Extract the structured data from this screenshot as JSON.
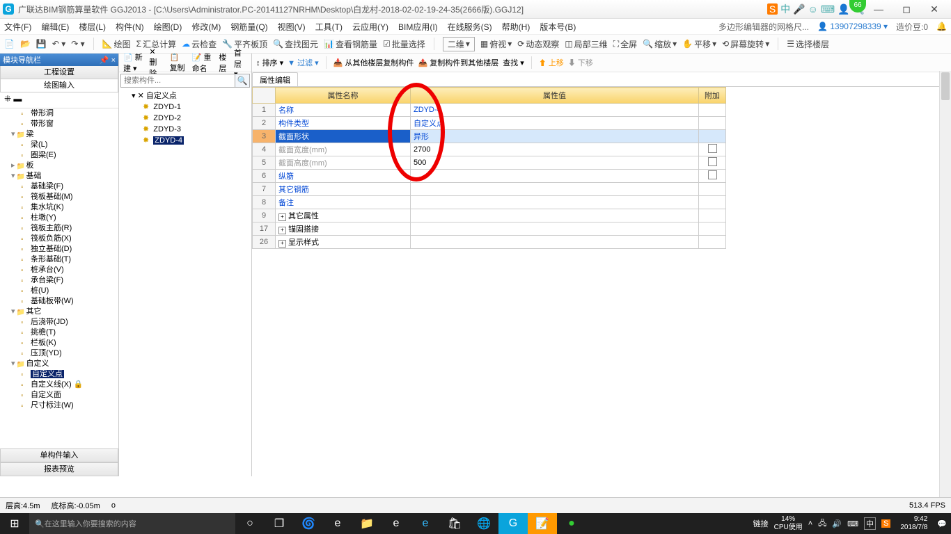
{
  "title": "广联达BIM钢筋算量软件 GGJ2013 - [C:\\Users\\Administrator.PC-20141127NRHM\\Desktop\\白龙村-2018-02-02-19-24-35(2666版).GGJ12]",
  "badge66": "66",
  "menubar": [
    "文件(F)",
    "编辑(E)",
    "楼层(L)",
    "构件(N)",
    "绘图(D)",
    "修改(M)",
    "钢筋量(Q)",
    "视图(V)",
    "工具(T)",
    "云应用(Y)",
    "BIM应用(I)",
    "在线服务(S)",
    "帮助(H)",
    "版本号(B)"
  ],
  "menubar_r": {
    "tip": "多边形编辑器的网格尺...",
    "user": "13907298339",
    "coin": "造价豆:0"
  },
  "toolbar1": [
    "绘图",
    "汇总计算",
    "云检查",
    "平齐板顶",
    "查找图元",
    "查看钢筋量",
    "批量选择",
    "二维",
    "俯视",
    "动态观察",
    "局部三维",
    "全屏",
    "缩放",
    "平移",
    "屏幕旋转",
    "选择楼层"
  ],
  "left": {
    "header": "模块导航栏",
    "tabs": [
      "工程设置",
      "绘图输入"
    ],
    "bottom": [
      "单构件输入",
      "报表预览"
    ],
    "tree": [
      {
        "l": "带形洞",
        "i": 1
      },
      {
        "l": "带形窗",
        "i": 1
      },
      {
        "l": "梁",
        "f": true,
        "open": true,
        "i": 0
      },
      {
        "l": "梁(L)",
        "i": 1
      },
      {
        "l": "圈梁(E)",
        "i": 1
      },
      {
        "l": "板",
        "f": true,
        "i": 0
      },
      {
        "l": "基础",
        "f": true,
        "open": true,
        "i": 0
      },
      {
        "l": "基础梁(F)",
        "i": 1
      },
      {
        "l": "筏板基础(M)",
        "i": 1
      },
      {
        "l": "集水坑(K)",
        "i": 1
      },
      {
        "l": "柱墩(Y)",
        "i": 1
      },
      {
        "l": "筏板主筋(R)",
        "i": 1
      },
      {
        "l": "筏板负筋(X)",
        "i": 1
      },
      {
        "l": "独立基础(D)",
        "i": 1
      },
      {
        "l": "条形基础(T)",
        "i": 1
      },
      {
        "l": "桩承台(V)",
        "i": 1
      },
      {
        "l": "承台梁(F)",
        "i": 1
      },
      {
        "l": "桩(U)",
        "i": 1
      },
      {
        "l": "基础板带(W)",
        "i": 1
      },
      {
        "l": "其它",
        "f": true,
        "open": true,
        "i": 0
      },
      {
        "l": "后浇带(JD)",
        "i": 1
      },
      {
        "l": "挑檐(T)",
        "i": 1
      },
      {
        "l": "栏板(K)",
        "i": 1
      },
      {
        "l": "压顶(YD)",
        "i": 1
      },
      {
        "l": "自定义",
        "f": true,
        "open": true,
        "i": 0
      },
      {
        "l": "自定义点",
        "i": 1,
        "sel": true
      },
      {
        "l": "自定义线(X)",
        "i": 1,
        "lock": true
      },
      {
        "l": "自定义面",
        "i": 1
      },
      {
        "l": "尺寸标注(W)",
        "i": 1
      }
    ]
  },
  "mid": {
    "toolbar": [
      "新建",
      "删除",
      "复制",
      "重命名",
      "楼层",
      "首层"
    ],
    "search_ph": "搜索构件...",
    "root": "自定义点",
    "items": [
      "ZDYD-1",
      "ZDYD-2",
      "ZDYD-3",
      "ZDYD-4"
    ],
    "sel": "ZDYD-4"
  },
  "right": {
    "toolbar": [
      "排序",
      "过滤",
      "从其他楼层复制构件",
      "复制构件到其他楼层",
      "查找",
      "上移",
      "下移"
    ],
    "tab": "属性编辑",
    "cols": {
      "name": "属性名称",
      "val": "属性值",
      "att": "附加"
    },
    "rows": [
      {
        "n": "1",
        "name": "名称",
        "val": "ZDYD-4",
        "link": true
      },
      {
        "n": "2",
        "name": "构件类型",
        "val": "自定义点",
        "link": true
      },
      {
        "n": "3",
        "name": "截面形状",
        "val": "异形",
        "link": true,
        "sel": true
      },
      {
        "n": "4",
        "name": "截面宽度(mm)",
        "val": "2700",
        "gray": true,
        "chk": true
      },
      {
        "n": "5",
        "name": "截面高度(mm)",
        "val": "500",
        "gray": true,
        "chk": true
      },
      {
        "n": "6",
        "name": "纵筋",
        "val": "",
        "link": true,
        "chk": true
      },
      {
        "n": "7",
        "name": "其它钢筋",
        "val": "",
        "link": true
      },
      {
        "n": "8",
        "name": "备注",
        "val": "",
        "link": true
      },
      {
        "n": "9",
        "name": "其它属性",
        "val": "",
        "exp": true
      },
      {
        "n": "17",
        "name": "锚固搭接",
        "val": "",
        "exp": true
      },
      {
        "n": "26",
        "name": "显示样式",
        "val": "",
        "exp": true
      }
    ]
  },
  "status": {
    "ceng": "层高:4.5m",
    "di": "底标高:-0.05m",
    "o": "o",
    "fps": "513.4 FPS"
  },
  "taskbar": {
    "search": "在这里输入你要搜索的内容",
    "link": "链接",
    "cpu1": "14%",
    "cpu2": "CPU使用",
    "time": "9:42",
    "date": "2018/7/8"
  }
}
